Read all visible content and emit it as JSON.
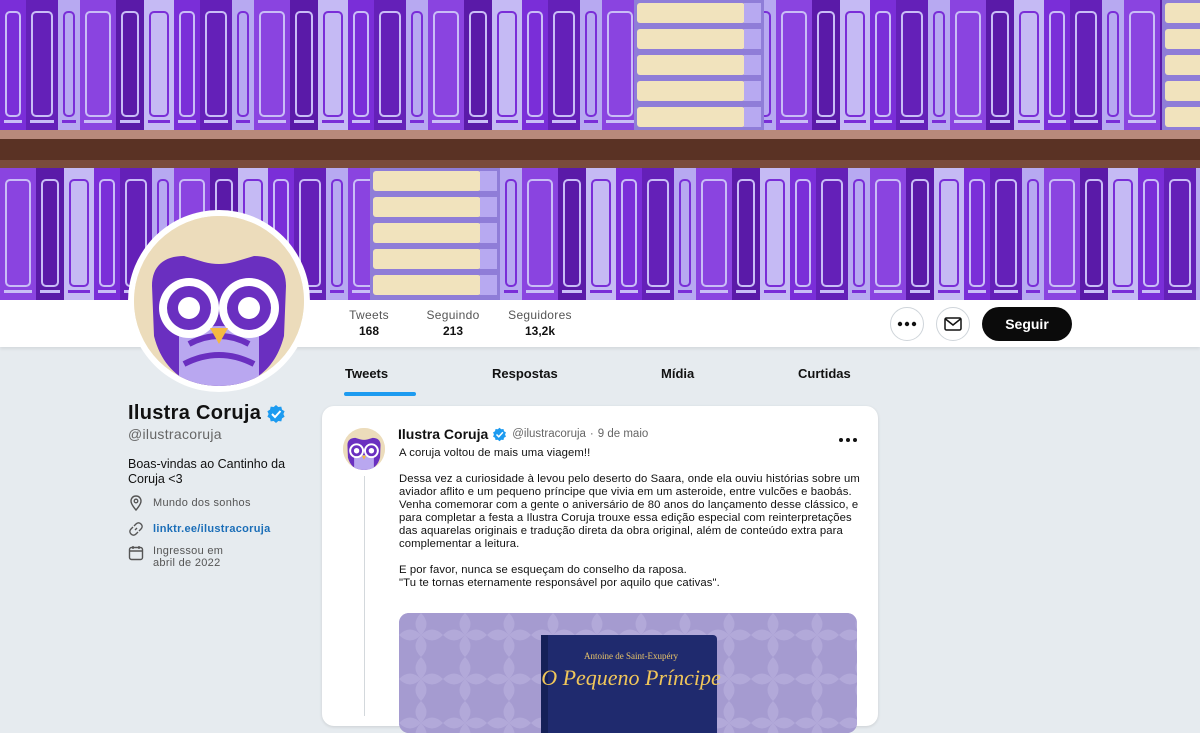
{
  "colors": {
    "accent": "#1d9bf0",
    "banner_purple": "#7a2ed8",
    "book_light": "#b7a9f1",
    "shelf": "#5a3224",
    "follow_bg": "#0b0b0b",
    "link": "#1b6eb8"
  },
  "profile": {
    "name": "Ilustra Coruja",
    "handle": "@ilustracoruja",
    "verified_icon": "verified-badge-icon",
    "bio": "Boas-vindas ao Cantinho da Coruja <3",
    "location": "Mundo dos sonhos",
    "link": "linktr.ee/ilustracoruja",
    "joined": "Ingressou em abril de 2022"
  },
  "stats": [
    {
      "label": "Tweets",
      "value": "168"
    },
    {
      "label": "Seguindo",
      "value": "213"
    },
    {
      "label": "Seguidores",
      "value": "13,2k"
    }
  ],
  "actions": {
    "more_icon": "more-icon",
    "message_icon": "mail-icon",
    "follow_label": "Seguir"
  },
  "tabs": [
    {
      "label": "Tweets",
      "active": true
    },
    {
      "label": "Respostas"
    },
    {
      "label": "Mídia"
    },
    {
      "label": "Curtidas"
    }
  ],
  "tweet": {
    "author": "Ilustra Coruja",
    "handle": "@ilustracoruja",
    "separator": "·",
    "date": "9 de maio",
    "paragraphs": [
      "A coruja voltou de mais uma viagem!!",
      "Dessa vez a curiosidade à levou pelo deserto do Saara, onde ela ouviu histórias sobre um aviador aflito e um pequeno príncipe que vivia em um asteroide, entre vulcões e baobás. Venha comemorar com a gente o aniversário de 80 anos do lançamento desse clássico, e para completar a festa a Ilustra Coruja trouxe essa edição especial com reinterpretações das aquarelas originais e tradução direta da obra original, além de conteúdo extra para complementar a leitura.",
      "E por favor, nunca se esqueçam do conselho da raposa.\n\"Tu te tornas eternamente responsável por aquilo que cativas\"."
    ],
    "media": {
      "author": "Antoine de Saint-Exupéry",
      "title": "O Pequeno Príncipe"
    }
  }
}
